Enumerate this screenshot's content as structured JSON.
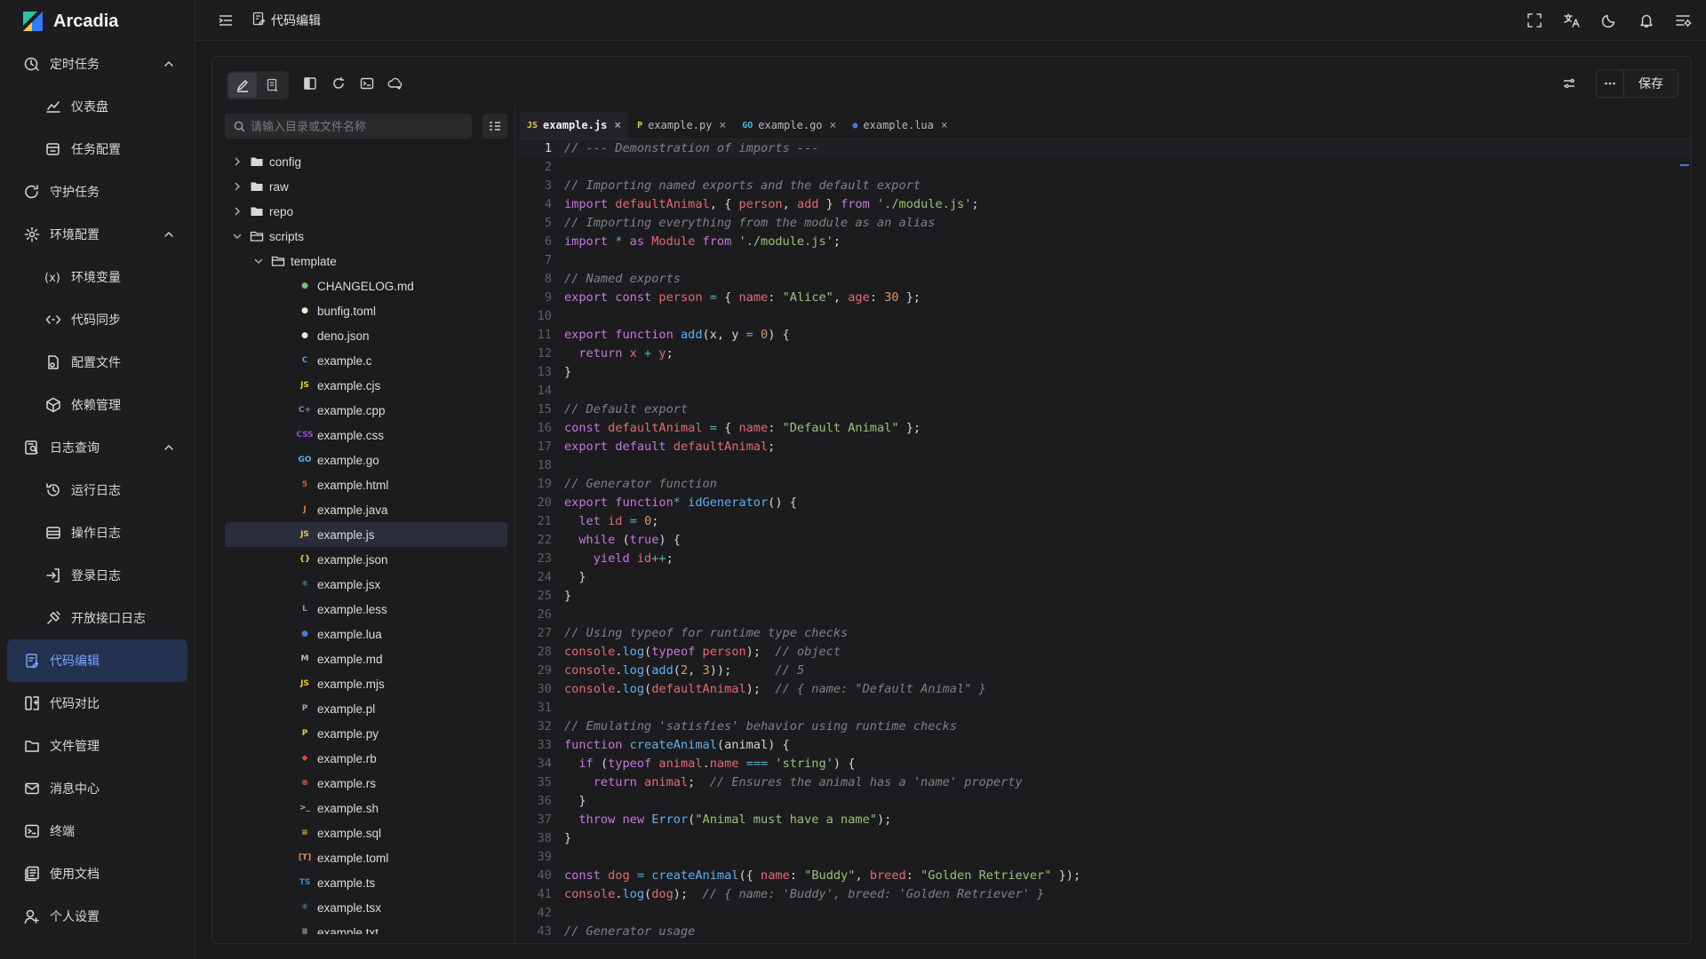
{
  "app": {
    "title": "Arcadia"
  },
  "sidebar": {
    "items": [
      {
        "label": "定时任务",
        "level": 0,
        "icon": "clock-icon",
        "expandable": true,
        "expanded": true
      },
      {
        "label": "仪表盘",
        "level": 1,
        "icon": "chart-line-icon"
      },
      {
        "label": "任务配置",
        "level": 1,
        "icon": "task-config-icon"
      },
      {
        "label": "守护任务",
        "level": 0,
        "icon": "guard-icon"
      },
      {
        "label": "环境配置",
        "level": 0,
        "icon": "gear-icon",
        "expandable": true,
        "expanded": true
      },
      {
        "label": "环境变量",
        "level": 1,
        "icon": "variable-icon"
      },
      {
        "label": "代码同步",
        "level": 1,
        "icon": "code-sync-icon"
      },
      {
        "label": "配置文件",
        "level": 1,
        "icon": "config-file-icon"
      },
      {
        "label": "依赖管理",
        "level": 1,
        "icon": "package-icon"
      },
      {
        "label": "日志查询",
        "level": 0,
        "icon": "log-search-icon",
        "expandable": true,
        "expanded": true
      },
      {
        "label": "运行日志",
        "level": 1,
        "icon": "history-icon"
      },
      {
        "label": "操作日志",
        "level": 1,
        "icon": "operation-log-icon"
      },
      {
        "label": "登录日志",
        "level": 1,
        "icon": "login-icon"
      },
      {
        "label": "开放接口日志",
        "level": 1,
        "icon": "api-icon"
      },
      {
        "label": "代码编辑",
        "level": 0,
        "icon": "code-edit-icon",
        "active": true
      },
      {
        "label": "代码对比",
        "level": 0,
        "icon": "diff-icon"
      },
      {
        "label": "文件管理",
        "level": 0,
        "icon": "folder-icon"
      },
      {
        "label": "消息中心",
        "level": 0,
        "icon": "mail-icon"
      },
      {
        "label": "终端",
        "level": 0,
        "icon": "terminal-icon"
      },
      {
        "label": "使用文档",
        "level": 0,
        "icon": "docs-icon"
      },
      {
        "label": "个人设置",
        "level": 0,
        "icon": "user-settings-icon"
      }
    ]
  },
  "topbar": {
    "page_title": "代码编辑",
    "icons": [
      "fullscreen-icon",
      "translate-icon",
      "moon-icon",
      "bell-icon",
      "layout-settings-icon"
    ]
  },
  "toolbar": {
    "save_label": "保存"
  },
  "explorer": {
    "search_placeholder": "请输入目录或文件名称",
    "tree": [
      {
        "name": "config",
        "type": "folder",
        "depth": 0,
        "expanded": false
      },
      {
        "name": "raw",
        "type": "folder",
        "depth": 0,
        "expanded": false
      },
      {
        "name": "repo",
        "type": "folder",
        "depth": 0,
        "expanded": false
      },
      {
        "name": "scripts",
        "type": "folder",
        "depth": 0,
        "expanded": true
      },
      {
        "name": "template",
        "type": "folder",
        "depth": 1,
        "expanded": true
      },
      {
        "name": "CHANGELOG.md",
        "type": "file",
        "depth": 2,
        "icon": "changelog-icon",
        "color": "#6fc27a"
      },
      {
        "name": "bunfig.toml",
        "type": "file",
        "depth": 2,
        "icon": "bun-icon",
        "color": "#f3e6d3"
      },
      {
        "name": "deno.json",
        "type": "file",
        "depth": 2,
        "icon": "deno-icon",
        "color": "#e8e8e8"
      },
      {
        "name": "example.c",
        "type": "file",
        "depth": 2,
        "icon": "c-icon",
        "color": "#5b8def",
        "glyph": "C"
      },
      {
        "name": "example.cjs",
        "type": "file",
        "depth": 2,
        "icon": "js-icon",
        "color": "#e8c84a",
        "glyph": "JS"
      },
      {
        "name": "example.cpp",
        "type": "file",
        "depth": 2,
        "icon": "cpp-icon",
        "color": "#a074c4",
        "glyph": "C+"
      },
      {
        "name": "example.css",
        "type": "file",
        "depth": 2,
        "icon": "css-icon",
        "color": "#8a4fd1",
        "glyph": "CSS"
      },
      {
        "name": "example.go",
        "type": "file",
        "depth": 2,
        "icon": "go-icon",
        "color": "#53b5e3",
        "glyph": "GO"
      },
      {
        "name": "example.html",
        "type": "file",
        "depth": 2,
        "icon": "html-icon",
        "color": "#e4572e",
        "glyph": "5"
      },
      {
        "name": "example.java",
        "type": "file",
        "depth": 2,
        "icon": "java-icon",
        "color": "#d9843a",
        "glyph": "J"
      },
      {
        "name": "example.js",
        "type": "file",
        "depth": 2,
        "icon": "js-icon",
        "color": "#e8c84a",
        "glyph": "JS",
        "selected": true
      },
      {
        "name": "example.json",
        "type": "file",
        "depth": 2,
        "icon": "json-icon",
        "color": "#e8c84a",
        "glyph": "{}"
      },
      {
        "name": "example.jsx",
        "type": "file",
        "depth": 2,
        "icon": "react-icon",
        "color": "#5ccfe6",
        "glyph": "⚛"
      },
      {
        "name": "example.less",
        "type": "file",
        "depth": 2,
        "icon": "less-icon",
        "color": "#6aa0e0",
        "glyph": "L"
      },
      {
        "name": "example.lua",
        "type": "file",
        "depth": 2,
        "icon": "lua-icon",
        "color": "#4a7bd8",
        "glyph": "●"
      },
      {
        "name": "example.md",
        "type": "file",
        "depth": 2,
        "icon": "markdown-icon",
        "color": "#bbbbbb",
        "glyph": "M"
      },
      {
        "name": "example.mjs",
        "type": "file",
        "depth": 2,
        "icon": "js-icon",
        "color": "#e8c84a",
        "glyph": "JS"
      },
      {
        "name": "example.pl",
        "type": "file",
        "depth": 2,
        "icon": "perl-icon",
        "color": "#9aa4b8",
        "glyph": "P"
      },
      {
        "name": "example.py",
        "type": "file",
        "depth": 2,
        "icon": "python-icon",
        "color": "#e8c84a",
        "glyph": "P"
      },
      {
        "name": "example.rb",
        "type": "file",
        "depth": 2,
        "icon": "ruby-icon",
        "color": "#e0463a",
        "glyph": "◆"
      },
      {
        "name": "example.rs",
        "type": "file",
        "depth": 2,
        "icon": "rust-icon",
        "color": "#e0663a",
        "glyph": "⊗"
      },
      {
        "name": "example.sh",
        "type": "file",
        "depth": 2,
        "icon": "shell-icon",
        "color": "#b0b0b0",
        "glyph": ">_"
      },
      {
        "name": "example.sql",
        "type": "file",
        "depth": 2,
        "icon": "sql-icon",
        "color": "#f2b632",
        "glyph": "≡"
      },
      {
        "name": "example.toml",
        "type": "file",
        "depth": 2,
        "icon": "toml-icon",
        "color": "#d08a55",
        "glyph": "[T]"
      },
      {
        "name": "example.ts",
        "type": "file",
        "depth": 2,
        "icon": "ts-icon",
        "color": "#3f84d6",
        "glyph": "TS"
      },
      {
        "name": "example.tsx",
        "type": "file",
        "depth": 2,
        "icon": "react-icon",
        "color": "#5ccfe6",
        "glyph": "⚛"
      },
      {
        "name": "example.txt",
        "type": "file",
        "depth": 2,
        "icon": "text-icon",
        "color": "#aaaaaa",
        "glyph": "≣"
      }
    ]
  },
  "editor": {
    "tabs": [
      {
        "label": "example.js",
        "icon": "js-icon",
        "glyph": "JS",
        "color": "#e8c84a",
        "active": true
      },
      {
        "label": "example.py",
        "icon": "python-icon",
        "glyph": "P",
        "color": "#e8c84a"
      },
      {
        "label": "example.go",
        "icon": "go-icon",
        "glyph": "GO",
        "color": "#53b5e3"
      },
      {
        "label": "example.lua",
        "icon": "lua-icon",
        "glyph": "●",
        "color": "#4a7bd8"
      }
    ],
    "current_line": 1,
    "lines": [
      [
        [
          "comment",
          "// --- Demonstration of imports ---"
        ]
      ],
      [],
      [
        [
          "comment",
          "// Importing named exports and the default export"
        ]
      ],
      [
        [
          "keyword",
          "import "
        ],
        [
          "var",
          "defaultAnimal"
        ],
        [
          "plain",
          ", { "
        ],
        [
          "var",
          "person"
        ],
        [
          "plain",
          ", "
        ],
        [
          "var",
          "add"
        ],
        [
          "plain",
          " } "
        ],
        [
          "keyword",
          "from "
        ],
        [
          "str",
          "'./module.js'"
        ],
        [
          "plain",
          ";"
        ]
      ],
      [
        [
          "comment",
          "// Importing everything from the module as an alias"
        ]
      ],
      [
        [
          "keyword",
          "import "
        ],
        [
          "op",
          "* "
        ],
        [
          "keyword",
          "as "
        ],
        [
          "var",
          "Module "
        ],
        [
          "keyword",
          "from "
        ],
        [
          "str",
          "'./module.js'"
        ],
        [
          "plain",
          ";"
        ]
      ],
      [],
      [
        [
          "comment",
          "// Named exports"
        ]
      ],
      [
        [
          "keyword",
          "export const "
        ],
        [
          "var",
          "person "
        ],
        [
          "op",
          "= "
        ],
        [
          "plain",
          "{ "
        ],
        [
          "var",
          "name"
        ],
        [
          "plain",
          ": "
        ],
        [
          "str",
          "\"Alice\""
        ],
        [
          "plain",
          ", "
        ],
        [
          "var",
          "age"
        ],
        [
          "plain",
          ": "
        ],
        [
          "num",
          "30"
        ],
        [
          "plain",
          " };"
        ]
      ],
      [],
      [
        [
          "keyword",
          "export function "
        ],
        [
          "fn",
          "add"
        ],
        [
          "plain",
          "(x, y "
        ],
        [
          "op",
          "= "
        ],
        [
          "num",
          "0"
        ],
        [
          "plain",
          ") {"
        ]
      ],
      [
        [
          "plain",
          "  "
        ],
        [
          "keyword",
          "return "
        ],
        [
          "var",
          "x "
        ],
        [
          "op",
          "+ "
        ],
        [
          "var",
          "y"
        ],
        [
          "plain",
          ";"
        ]
      ],
      [
        [
          "plain",
          "}"
        ]
      ],
      [],
      [
        [
          "comment",
          "// Default export"
        ]
      ],
      [
        [
          "keyword",
          "const "
        ],
        [
          "var",
          "defaultAnimal "
        ],
        [
          "op",
          "= "
        ],
        [
          "plain",
          "{ "
        ],
        [
          "var",
          "name"
        ],
        [
          "plain",
          ": "
        ],
        [
          "str",
          "\"Default Animal\""
        ],
        [
          "plain",
          " };"
        ]
      ],
      [
        [
          "keyword",
          "export default "
        ],
        [
          "var",
          "defaultAnimal"
        ],
        [
          "plain",
          ";"
        ]
      ],
      [],
      [
        [
          "comment",
          "// Generator function"
        ]
      ],
      [
        [
          "keyword",
          "export function"
        ],
        [
          "op",
          "* "
        ],
        [
          "fn",
          "idGenerator"
        ],
        [
          "plain",
          "() {"
        ]
      ],
      [
        [
          "plain",
          "  "
        ],
        [
          "keyword",
          "let "
        ],
        [
          "var",
          "id "
        ],
        [
          "op",
          "= "
        ],
        [
          "num",
          "0"
        ],
        [
          "plain",
          ";"
        ]
      ],
      [
        [
          "plain",
          "  "
        ],
        [
          "keyword",
          "while "
        ],
        [
          "plain",
          "("
        ],
        [
          "keyword",
          "true"
        ],
        [
          "plain",
          ") {"
        ]
      ],
      [
        [
          "plain",
          "    "
        ],
        [
          "keyword",
          "yield "
        ],
        [
          "var",
          "id"
        ],
        [
          "op",
          "++"
        ],
        [
          "plain",
          ";"
        ]
      ],
      [
        [
          "plain",
          "  }"
        ]
      ],
      [
        [
          "plain",
          "}"
        ]
      ],
      [],
      [
        [
          "comment",
          "// Using typeof for runtime type checks"
        ]
      ],
      [
        [
          "var",
          "console"
        ],
        [
          "plain",
          "."
        ],
        [
          "fn",
          "log"
        ],
        [
          "plain",
          "("
        ],
        [
          "keyword",
          "typeof "
        ],
        [
          "var",
          "person"
        ],
        [
          "plain",
          ");  "
        ],
        [
          "comment",
          "// object"
        ]
      ],
      [
        [
          "var",
          "console"
        ],
        [
          "plain",
          "."
        ],
        [
          "fn",
          "log"
        ],
        [
          "plain",
          "("
        ],
        [
          "fn",
          "add"
        ],
        [
          "plain",
          "("
        ],
        [
          "num",
          "2"
        ],
        [
          "plain",
          ", "
        ],
        [
          "num",
          "3"
        ],
        [
          "plain",
          "));      "
        ],
        [
          "comment",
          "// 5"
        ]
      ],
      [
        [
          "var",
          "console"
        ],
        [
          "plain",
          "."
        ],
        [
          "fn",
          "log"
        ],
        [
          "plain",
          "("
        ],
        [
          "var",
          "defaultAnimal"
        ],
        [
          "plain",
          ");  "
        ],
        [
          "comment",
          "// { name: \"Default Animal\" }"
        ]
      ],
      [],
      [
        [
          "comment",
          "// Emulating 'satisfies' behavior using runtime checks"
        ]
      ],
      [
        [
          "keyword",
          "function "
        ],
        [
          "fn",
          "createAnimal"
        ],
        [
          "plain",
          "(animal) {"
        ]
      ],
      [
        [
          "plain",
          "  "
        ],
        [
          "keyword",
          "if "
        ],
        [
          "plain",
          "("
        ],
        [
          "keyword",
          "typeof "
        ],
        [
          "var",
          "animal"
        ],
        [
          "plain",
          "."
        ],
        [
          "var",
          "name "
        ],
        [
          "op",
          "=== "
        ],
        [
          "str",
          "'string'"
        ],
        [
          "plain",
          ") {"
        ]
      ],
      [
        [
          "plain",
          "    "
        ],
        [
          "keyword",
          "return "
        ],
        [
          "var",
          "animal"
        ],
        [
          "plain",
          ";  "
        ],
        [
          "comment",
          "// Ensures the animal has a 'name' property"
        ]
      ],
      [
        [
          "plain",
          "  }"
        ]
      ],
      [
        [
          "plain",
          "  "
        ],
        [
          "keyword",
          "throw new "
        ],
        [
          "fn",
          "Error"
        ],
        [
          "plain",
          "("
        ],
        [
          "str",
          "\"Animal must have a name\""
        ],
        [
          "plain",
          ");"
        ]
      ],
      [
        [
          "plain",
          "}"
        ]
      ],
      [],
      [
        [
          "keyword",
          "const "
        ],
        [
          "var",
          "dog "
        ],
        [
          "op",
          "= "
        ],
        [
          "fn",
          "createAnimal"
        ],
        [
          "plain",
          "({ "
        ],
        [
          "var",
          "name"
        ],
        [
          "plain",
          ": "
        ],
        [
          "str",
          "\"Buddy\""
        ],
        [
          "plain",
          ", "
        ],
        [
          "var",
          "breed"
        ],
        [
          "plain",
          ": "
        ],
        [
          "str",
          "\"Golden Retriever\""
        ],
        [
          "plain",
          " });"
        ]
      ],
      [
        [
          "var",
          "console"
        ],
        [
          "plain",
          "."
        ],
        [
          "fn",
          "log"
        ],
        [
          "plain",
          "("
        ],
        [
          "var",
          "dog"
        ],
        [
          "plain",
          ");  "
        ],
        [
          "comment",
          "// { name: 'Buddy', breed: 'Golden Retriever' }"
        ]
      ],
      [],
      [
        [
          "comment",
          "// Generator usage"
        ]
      ]
    ]
  }
}
